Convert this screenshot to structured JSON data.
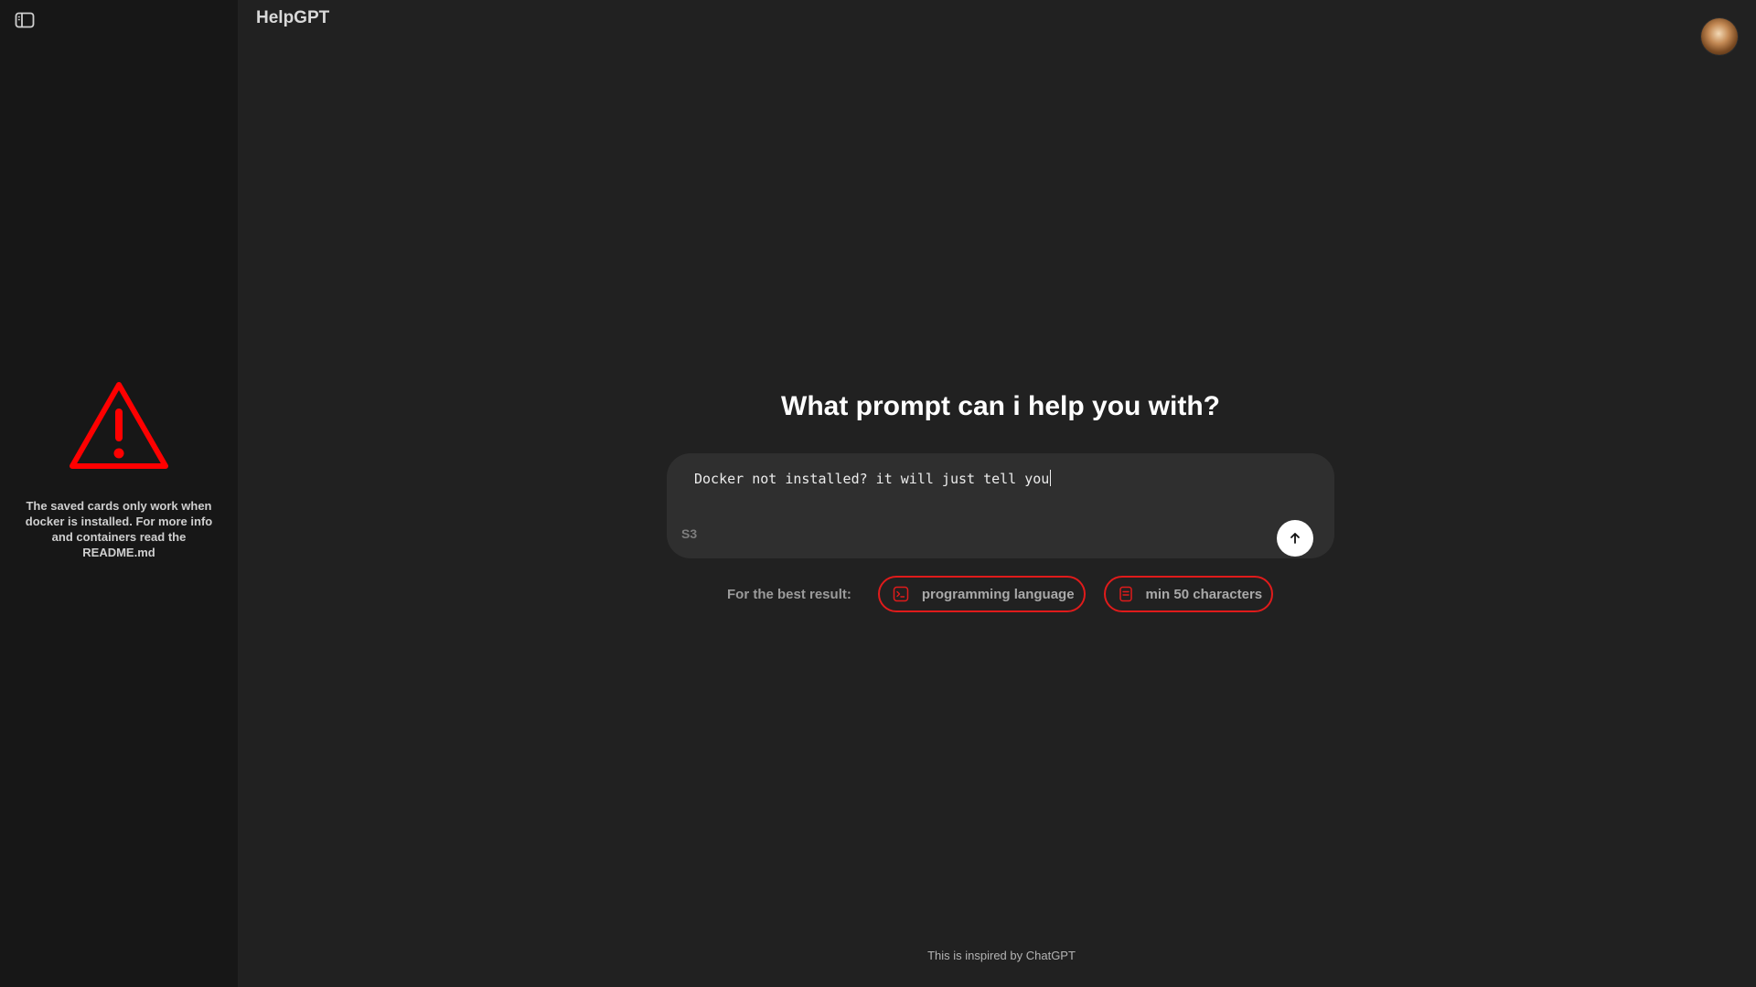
{
  "app": {
    "title": "HelpGPT"
  },
  "sidebar": {
    "toggle_icon": "sidebar-toggle-icon",
    "warning": {
      "icon": "warning-triangle-icon",
      "color": "#ff0000",
      "text": "The saved cards only work when docker is installed. For more info and containers read the README.md"
    }
  },
  "main": {
    "headline": "What prompt can i help you with?",
    "composer": {
      "input_value": "Docker not installed? it will just tell you",
      "model_label": "S3",
      "send_icon": "arrow-up-icon"
    },
    "hints": {
      "label": "For the best result:",
      "chips": [
        {
          "icon": "terminal-icon",
          "label": "programming language"
        },
        {
          "icon": "document-icon",
          "label": "min 50 characters"
        }
      ],
      "accent_color": "#e01b1b"
    }
  },
  "footer": {
    "note": "This is inspired by ChatGPT"
  },
  "colors": {
    "background": "#212121",
    "sidebar": "#171717",
    "composer": "#2f2f2f"
  }
}
